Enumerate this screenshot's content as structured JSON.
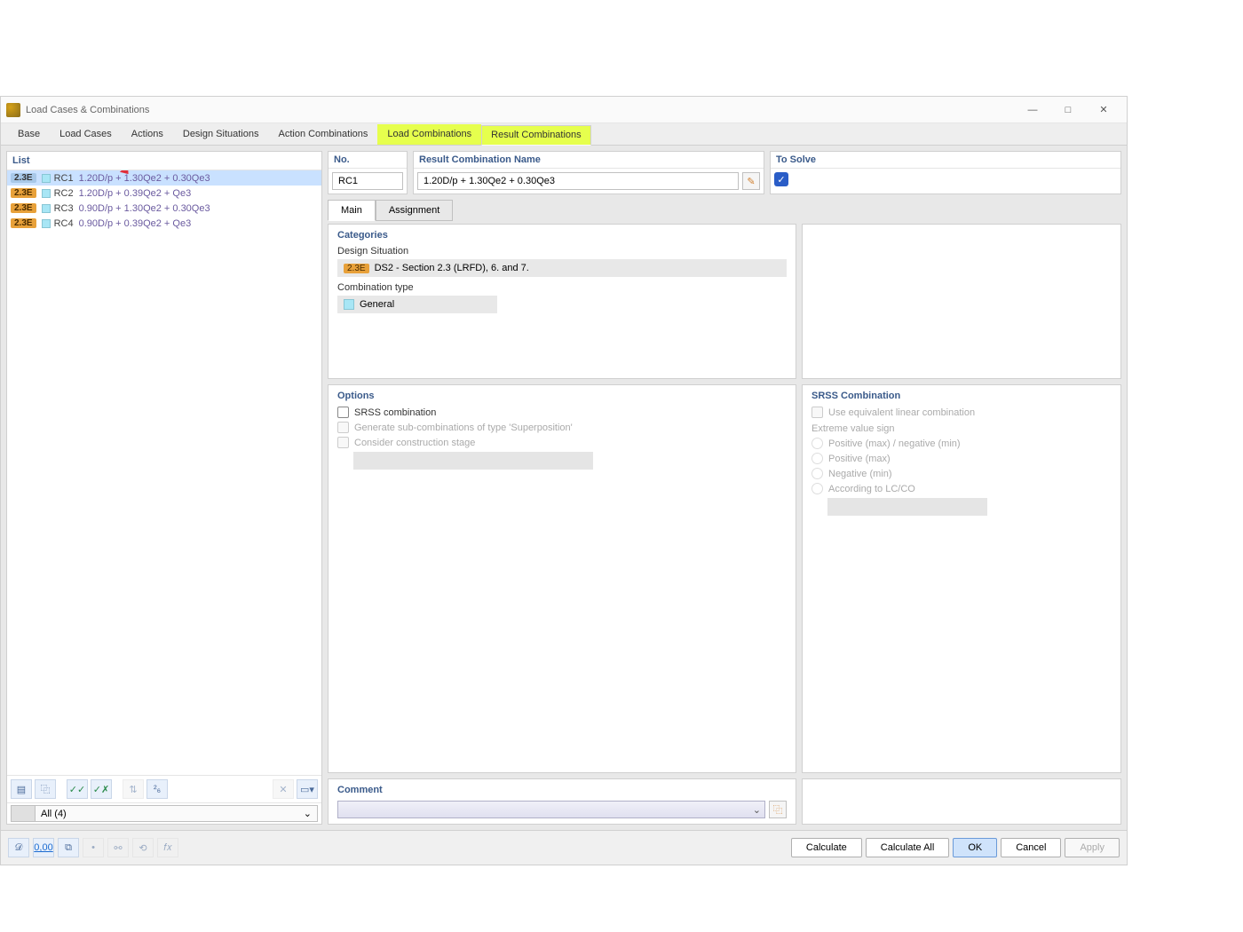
{
  "window": {
    "title": "Load Cases & Combinations"
  },
  "tabs": {
    "t0": "Base",
    "t1": "Load Cases",
    "t2": "Actions",
    "t3": "Design Situations",
    "t4": "Action Combinations",
    "t5": "Load Combinations",
    "t6": "Result Combinations"
  },
  "list": {
    "header": "List",
    "rows": [
      {
        "badge": "2.3E",
        "id": "RC1",
        "desc": "1.20D/p + 1.30Qe2 + 0.30Qe3"
      },
      {
        "badge": "2.3E",
        "id": "RC2",
        "desc": "1.20D/p + 0.39Qe2 + Qe3"
      },
      {
        "badge": "2.3E",
        "id": "RC3",
        "desc": "0.90D/p + 1.30Qe2 + 0.30Qe3"
      },
      {
        "badge": "2.3E",
        "id": "RC4",
        "desc": "0.90D/p + 0.39Qe2 + Qe3"
      }
    ],
    "filter": "All (4)"
  },
  "detail": {
    "no_label": "No.",
    "no_value": "RC1",
    "name_label": "Result Combination Name",
    "name_value": "1.20D/p + 1.30Qe2 + 0.30Qe3",
    "solve_label": "To Solve",
    "solve_checked": true,
    "subtabs": {
      "main": "Main",
      "assign": "Assignment"
    },
    "categories": {
      "title": "Categories",
      "ds_label": "Design Situation",
      "ds_badge": "2.3E",
      "ds_value": "DS2 - Section 2.3 (LRFD), 6. and 7.",
      "ct_label": "Combination type",
      "ct_value": "General"
    },
    "options": {
      "title": "Options",
      "srss": "SRSS combination",
      "gensub": "Generate sub-combinations of type 'Superposition'",
      "constr": "Consider construction stage"
    },
    "srss": {
      "title": "SRSS Combination",
      "useeq": "Use equivalent linear combination",
      "evsign": "Extreme value sign",
      "r1": "Positive (max) / negative (min)",
      "r2": "Positive (max)",
      "r3": "Negative (min)",
      "r4": "According to LC/CO"
    },
    "comment_label": "Comment"
  },
  "footer": {
    "calc": "Calculate",
    "calcall": "Calculate All",
    "ok": "OK",
    "cancel": "Cancel",
    "apply": "Apply"
  }
}
